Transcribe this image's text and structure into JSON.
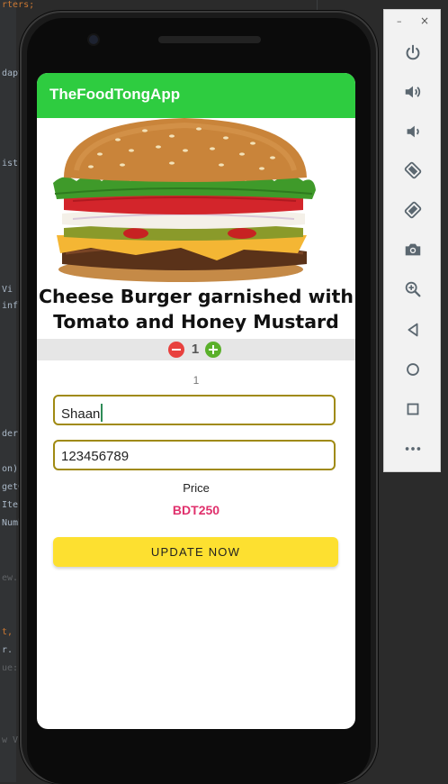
{
  "ide": {
    "lines": [
      "rters;",
      "dapt",
      "ist",
      "Vi",
      "infl",
      "der",
      "on)",
      "getC",
      "Iter",
      "Numb",
      "ew.",
      "t, ",
      "r.",
      "ue:",
      "w V"
    ]
  },
  "app": {
    "title": "TheFoodTongApp",
    "accent_color": "#2ecc40"
  },
  "product": {
    "image": "cheese-burger-image",
    "name": "Cheese Burger garnished with Tomato and Honey Mustard"
  },
  "stepper": {
    "minus_icon": "minus-circle-icon",
    "plus_icon": "plus-circle-icon",
    "value": "1"
  },
  "quantity_text": "1",
  "form": {
    "name_value": "Shaan",
    "phone_value": "123456789"
  },
  "price": {
    "label": "Price",
    "value": "BDT250",
    "color": "#e0306c"
  },
  "update_button": {
    "label": "UPDATE NOW",
    "color": "#fde030"
  },
  "emulator_toolbar": {
    "minimize": "–",
    "close": "×",
    "buttons": [
      "power-icon",
      "volume-up-icon",
      "volume-down-icon",
      "rotate-left-icon",
      "rotate-right-icon",
      "camera-icon",
      "zoom-icon",
      "back-icon",
      "home-icon",
      "overview-icon",
      "more-icon"
    ]
  }
}
